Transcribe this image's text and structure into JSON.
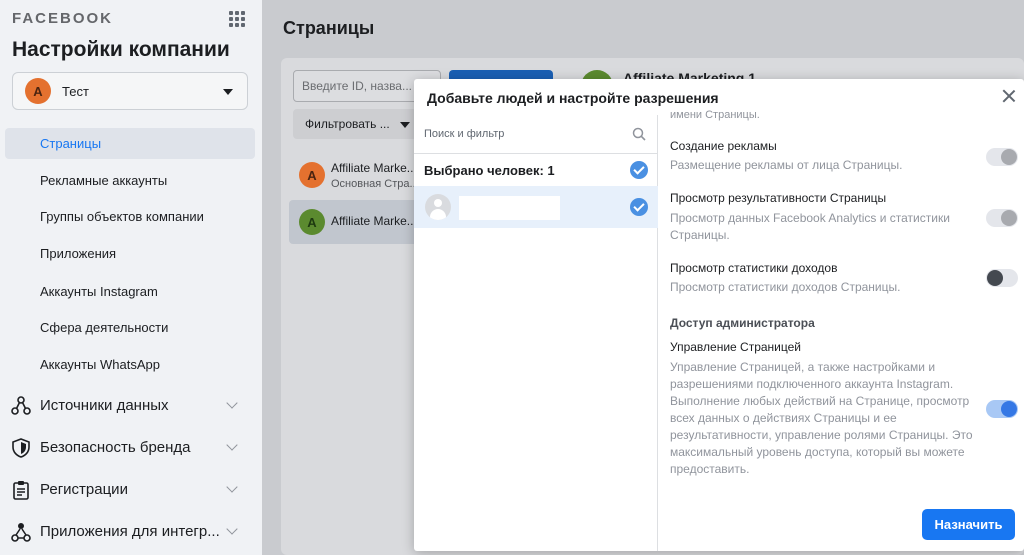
{
  "sidebar": {
    "brand": "FACEBOOK",
    "business_title": "Настройки компании",
    "account": {
      "avatar_letter": "А",
      "name": "Тест"
    },
    "items": [
      {
        "label": "Страницы",
        "active": true
      },
      {
        "label": "Рекламные аккаунты"
      },
      {
        "label": "Группы объектов компании"
      },
      {
        "label": "Приложения"
      },
      {
        "label": "Аккаунты Instagram"
      },
      {
        "label": "Сфера деятельности"
      },
      {
        "label": "Аккаунты WhatsApp"
      }
    ],
    "sections": [
      {
        "label": "Источники данных",
        "icon": "data-sources-icon"
      },
      {
        "label": "Безопасность бренда",
        "icon": "shield-icon"
      },
      {
        "label": "Регистрации",
        "icon": "clipboard-icon"
      },
      {
        "label": "Приложения для интегр...",
        "icon": "integration-icon"
      }
    ]
  },
  "main": {
    "page_title": "Страницы",
    "search_placeholder": "Введите ID, назва...",
    "filter_label": "Фильтровать ...",
    "pages": [
      {
        "avatar_letter": "А",
        "name": "Affiliate Marke...",
        "subtitle": "Основная Стра..."
      },
      {
        "avatar_letter": "A",
        "name": "Affiliate Marke..."
      }
    ],
    "detail_title": "Affiliate Marketing 1"
  },
  "modal": {
    "title": "Добавьте людей и настройте разрешения",
    "search_filter": "Поиск и фильтр",
    "selected_label": "Выбрано человек: 1",
    "cut_text": "имени Страницы.",
    "permissions": [
      {
        "title": "Создание рекламы",
        "desc": "Размещение рекламы от лица Страницы.",
        "state": "off"
      },
      {
        "title": "Просмотр результативности Страницы",
        "desc": "Просмотр данных Facebook Analytics и статистики Страницы.",
        "state": "off"
      },
      {
        "title": "Просмотр статистики доходов",
        "desc": "Просмотр статистики доходов Страницы.",
        "state": "dark"
      }
    ],
    "admin_group": "Доступ администратора",
    "admin_perm": {
      "title": "Управление Страницей",
      "desc": "Управление Страницей, а также настройками и разрешениями подключенного аккаунта Instagram. Выполнение любых действий на Странице, просмотр всех данных о действиях Страницы и ее результативности, управление ролями Страницы. Это максимальный уровень доступа, который вы можете предоставить.",
      "state": "on"
    },
    "assign_label": "Назначить"
  },
  "colors": {
    "accent": "#1877f2",
    "avatar_orange": "#e4712f",
    "avatar_green": "#5b8a2f"
  }
}
